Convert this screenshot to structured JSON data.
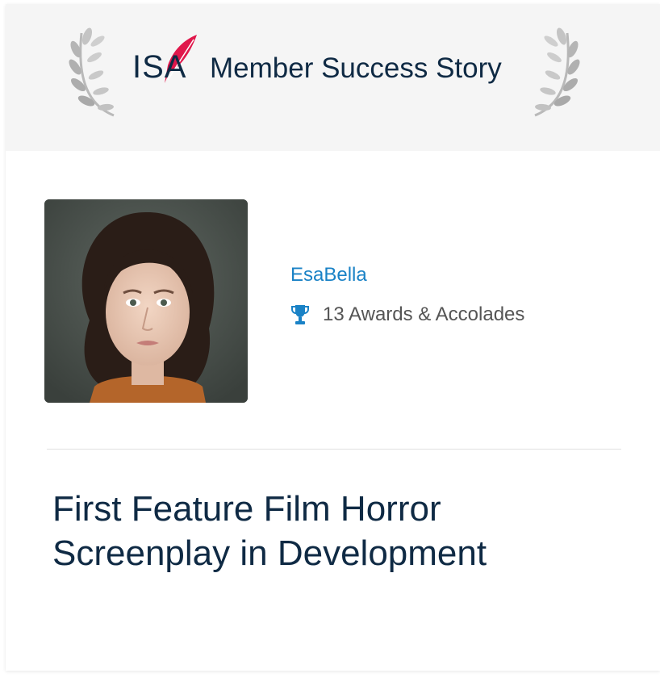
{
  "header": {
    "logo_text": "ISA",
    "title": "Member Success Story"
  },
  "member": {
    "name": "EsaBella",
    "awards_text": "13 Awards & Accolades",
    "awards_icon": "trophy-icon",
    "photo_alt": "EsaBella"
  },
  "story": {
    "title": "First Feature Film Horror Screenplay in Development"
  },
  "colors": {
    "header_bg": "#f5f5f5",
    "navy": "#0f2a44",
    "link_blue": "#1a82c6",
    "trophy_blue": "#1a82c6",
    "feather_red": "#e0174b",
    "muted_text": "#555555"
  }
}
